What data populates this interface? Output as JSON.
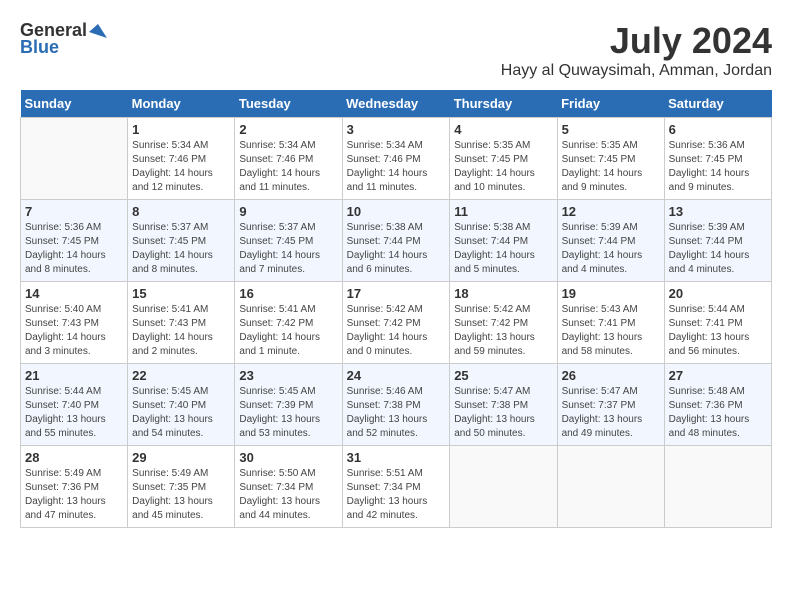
{
  "header": {
    "logo_general": "General",
    "logo_blue": "Blue",
    "month_year": "July 2024",
    "location": "Hayy al Quwaysimah, Amman, Jordan"
  },
  "days_of_week": [
    "Sunday",
    "Monday",
    "Tuesday",
    "Wednesday",
    "Thursday",
    "Friday",
    "Saturday"
  ],
  "weeks": [
    [
      {
        "day": "",
        "sunrise": "",
        "sunset": "",
        "daylight": ""
      },
      {
        "day": "1",
        "sunrise": "Sunrise: 5:34 AM",
        "sunset": "Sunset: 7:46 PM",
        "daylight": "Daylight: 14 hours and 12 minutes."
      },
      {
        "day": "2",
        "sunrise": "Sunrise: 5:34 AM",
        "sunset": "Sunset: 7:46 PM",
        "daylight": "Daylight: 14 hours and 11 minutes."
      },
      {
        "day": "3",
        "sunrise": "Sunrise: 5:34 AM",
        "sunset": "Sunset: 7:46 PM",
        "daylight": "Daylight: 14 hours and 11 minutes."
      },
      {
        "day": "4",
        "sunrise": "Sunrise: 5:35 AM",
        "sunset": "Sunset: 7:45 PM",
        "daylight": "Daylight: 14 hours and 10 minutes."
      },
      {
        "day": "5",
        "sunrise": "Sunrise: 5:35 AM",
        "sunset": "Sunset: 7:45 PM",
        "daylight": "Daylight: 14 hours and 9 minutes."
      },
      {
        "day": "6",
        "sunrise": "Sunrise: 5:36 AM",
        "sunset": "Sunset: 7:45 PM",
        "daylight": "Daylight: 14 hours and 9 minutes."
      }
    ],
    [
      {
        "day": "7",
        "sunrise": "Sunrise: 5:36 AM",
        "sunset": "Sunset: 7:45 PM",
        "daylight": "Daylight: 14 hours and 8 minutes."
      },
      {
        "day": "8",
        "sunrise": "Sunrise: 5:37 AM",
        "sunset": "Sunset: 7:45 PM",
        "daylight": "Daylight: 14 hours and 8 minutes."
      },
      {
        "day": "9",
        "sunrise": "Sunrise: 5:37 AM",
        "sunset": "Sunset: 7:45 PM",
        "daylight": "Daylight: 14 hours and 7 minutes."
      },
      {
        "day": "10",
        "sunrise": "Sunrise: 5:38 AM",
        "sunset": "Sunset: 7:44 PM",
        "daylight": "Daylight: 14 hours and 6 minutes."
      },
      {
        "day": "11",
        "sunrise": "Sunrise: 5:38 AM",
        "sunset": "Sunset: 7:44 PM",
        "daylight": "Daylight: 14 hours and 5 minutes."
      },
      {
        "day": "12",
        "sunrise": "Sunrise: 5:39 AM",
        "sunset": "Sunset: 7:44 PM",
        "daylight": "Daylight: 14 hours and 4 minutes."
      },
      {
        "day": "13",
        "sunrise": "Sunrise: 5:39 AM",
        "sunset": "Sunset: 7:44 PM",
        "daylight": "Daylight: 14 hours and 4 minutes."
      }
    ],
    [
      {
        "day": "14",
        "sunrise": "Sunrise: 5:40 AM",
        "sunset": "Sunset: 7:43 PM",
        "daylight": "Daylight: 14 hours and 3 minutes."
      },
      {
        "day": "15",
        "sunrise": "Sunrise: 5:41 AM",
        "sunset": "Sunset: 7:43 PM",
        "daylight": "Daylight: 14 hours and 2 minutes."
      },
      {
        "day": "16",
        "sunrise": "Sunrise: 5:41 AM",
        "sunset": "Sunset: 7:42 PM",
        "daylight": "Daylight: 14 hours and 1 minute."
      },
      {
        "day": "17",
        "sunrise": "Sunrise: 5:42 AM",
        "sunset": "Sunset: 7:42 PM",
        "daylight": "Daylight: 14 hours and 0 minutes."
      },
      {
        "day": "18",
        "sunrise": "Sunrise: 5:42 AM",
        "sunset": "Sunset: 7:42 PM",
        "daylight": "Daylight: 13 hours and 59 minutes."
      },
      {
        "day": "19",
        "sunrise": "Sunrise: 5:43 AM",
        "sunset": "Sunset: 7:41 PM",
        "daylight": "Daylight: 13 hours and 58 minutes."
      },
      {
        "day": "20",
        "sunrise": "Sunrise: 5:44 AM",
        "sunset": "Sunset: 7:41 PM",
        "daylight": "Daylight: 13 hours and 56 minutes."
      }
    ],
    [
      {
        "day": "21",
        "sunrise": "Sunrise: 5:44 AM",
        "sunset": "Sunset: 7:40 PM",
        "daylight": "Daylight: 13 hours and 55 minutes."
      },
      {
        "day": "22",
        "sunrise": "Sunrise: 5:45 AM",
        "sunset": "Sunset: 7:40 PM",
        "daylight": "Daylight: 13 hours and 54 minutes."
      },
      {
        "day": "23",
        "sunrise": "Sunrise: 5:45 AM",
        "sunset": "Sunset: 7:39 PM",
        "daylight": "Daylight: 13 hours and 53 minutes."
      },
      {
        "day": "24",
        "sunrise": "Sunrise: 5:46 AM",
        "sunset": "Sunset: 7:38 PM",
        "daylight": "Daylight: 13 hours and 52 minutes."
      },
      {
        "day": "25",
        "sunrise": "Sunrise: 5:47 AM",
        "sunset": "Sunset: 7:38 PM",
        "daylight": "Daylight: 13 hours and 50 minutes."
      },
      {
        "day": "26",
        "sunrise": "Sunrise: 5:47 AM",
        "sunset": "Sunset: 7:37 PM",
        "daylight": "Daylight: 13 hours and 49 minutes."
      },
      {
        "day": "27",
        "sunrise": "Sunrise: 5:48 AM",
        "sunset": "Sunset: 7:36 PM",
        "daylight": "Daylight: 13 hours and 48 minutes."
      }
    ],
    [
      {
        "day": "28",
        "sunrise": "Sunrise: 5:49 AM",
        "sunset": "Sunset: 7:36 PM",
        "daylight": "Daylight: 13 hours and 47 minutes."
      },
      {
        "day": "29",
        "sunrise": "Sunrise: 5:49 AM",
        "sunset": "Sunset: 7:35 PM",
        "daylight": "Daylight: 13 hours and 45 minutes."
      },
      {
        "day": "30",
        "sunrise": "Sunrise: 5:50 AM",
        "sunset": "Sunset: 7:34 PM",
        "daylight": "Daylight: 13 hours and 44 minutes."
      },
      {
        "day": "31",
        "sunrise": "Sunrise: 5:51 AM",
        "sunset": "Sunset: 7:34 PM",
        "daylight": "Daylight: 13 hours and 42 minutes."
      },
      {
        "day": "",
        "sunrise": "",
        "sunset": "",
        "daylight": ""
      },
      {
        "day": "",
        "sunrise": "",
        "sunset": "",
        "daylight": ""
      },
      {
        "day": "",
        "sunrise": "",
        "sunset": "",
        "daylight": ""
      }
    ]
  ]
}
